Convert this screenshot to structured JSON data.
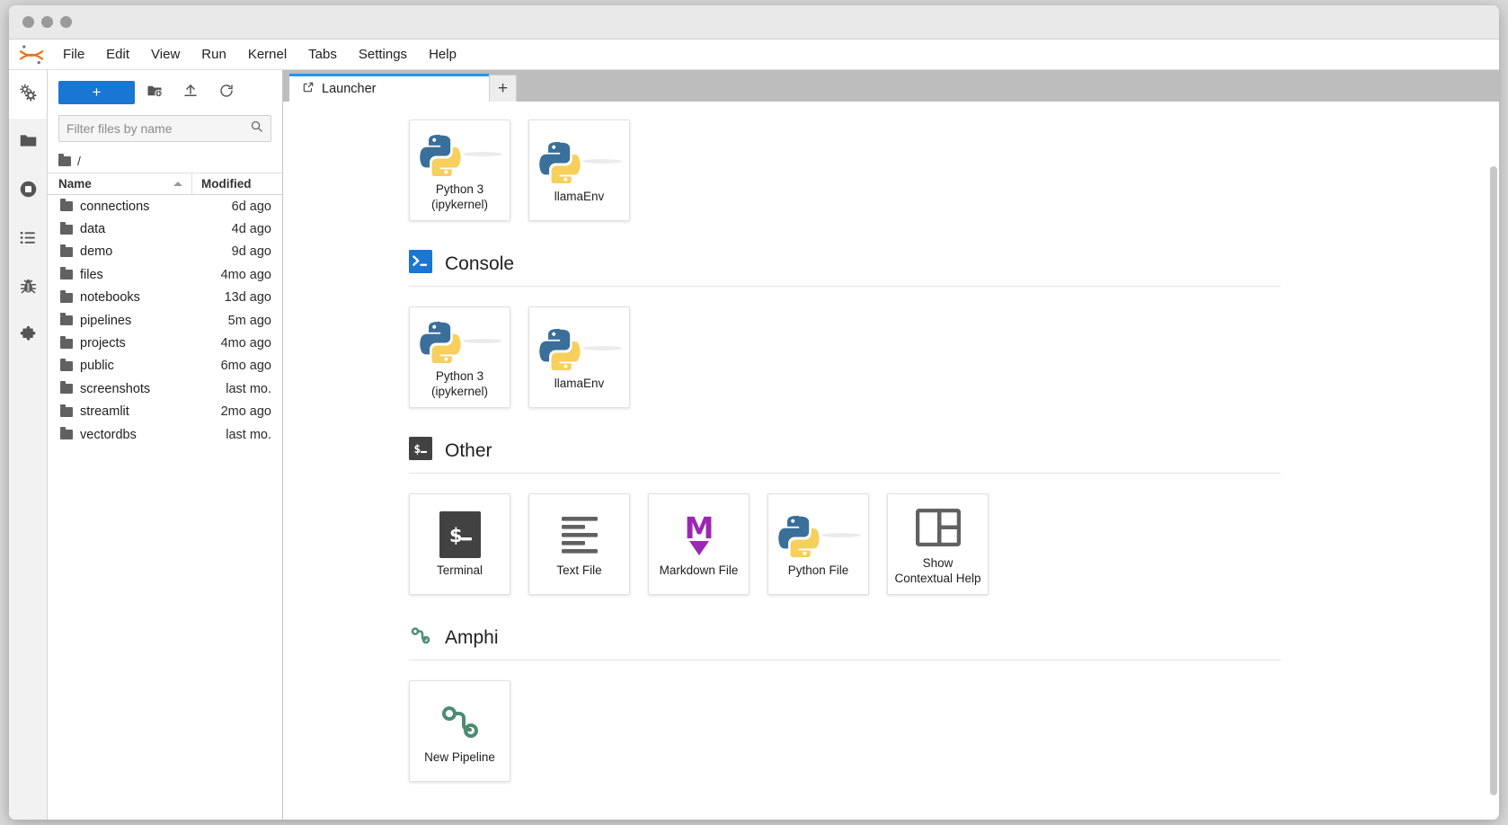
{
  "window": {
    "traffic_lights": [
      "close",
      "minimize",
      "maximize"
    ]
  },
  "menubar": {
    "logo": "jupyter-logo",
    "items": [
      {
        "label": "File"
      },
      {
        "label": "Edit"
      },
      {
        "label": "View"
      },
      {
        "label": "Run"
      },
      {
        "label": "Kernel"
      },
      {
        "label": "Tabs"
      },
      {
        "label": "Settings"
      },
      {
        "label": "Help"
      }
    ]
  },
  "rail": {
    "items": [
      {
        "name": "property-inspector",
        "icon": "gears-icon",
        "active": false
      },
      {
        "name": "file-browser",
        "icon": "folder-icon",
        "active": true
      },
      {
        "name": "running-terminals-kernels",
        "icon": "stop-circle-icon",
        "active": false
      },
      {
        "name": "table-of-contents",
        "icon": "list-icon",
        "active": false
      },
      {
        "name": "debugger",
        "icon": "bug-icon",
        "active": false
      },
      {
        "name": "extension-manager",
        "icon": "puzzle-icon",
        "active": false
      }
    ]
  },
  "filebrowser": {
    "toolbar": {
      "new_launcher_label": "+",
      "new_folder_icon": "new-folder-icon",
      "upload_icon": "upload-icon",
      "refresh_icon": "refresh-icon"
    },
    "filter": {
      "placeholder": "Filter files by name",
      "value": "",
      "icon": "search-icon"
    },
    "breadcrumb": {
      "root_icon": "folder-icon",
      "path": "/"
    },
    "columns": {
      "name": "Name",
      "modified": "Modified",
      "sort_column": "Name",
      "sort_direction": "ascending"
    },
    "files": [
      {
        "name": "connections",
        "modified": "6d ago",
        "type": "folder"
      },
      {
        "name": "data",
        "modified": "4d ago",
        "type": "folder"
      },
      {
        "name": "demo",
        "modified": "9d ago",
        "type": "folder"
      },
      {
        "name": "files",
        "modified": "4mo ago",
        "type": "folder"
      },
      {
        "name": "notebooks",
        "modified": "13d ago",
        "type": "folder"
      },
      {
        "name": "pipelines",
        "modified": "5m ago",
        "type": "folder"
      },
      {
        "name": "projects",
        "modified": "4mo ago",
        "type": "folder"
      },
      {
        "name": "public",
        "modified": "6mo ago",
        "type": "folder"
      },
      {
        "name": "screenshots",
        "modified": "last mo.",
        "type": "folder"
      },
      {
        "name": "streamlit",
        "modified": "2mo ago",
        "type": "folder"
      },
      {
        "name": "vectordbs",
        "modified": "last mo.",
        "type": "folder"
      }
    ]
  },
  "tabbar": {
    "tabs": [
      {
        "label": "Launcher",
        "icon": "launcher-icon",
        "active": true
      }
    ],
    "add_tab_label": "+"
  },
  "launcher": {
    "sections": [
      {
        "id": "notebook",
        "title": "",
        "icon": "",
        "cards": [
          {
            "label": "Python 3\n(ipykernel)",
            "icon": "python-logo-icon"
          },
          {
            "label": "llamaEnv",
            "icon": "python-logo-icon"
          }
        ]
      },
      {
        "id": "console",
        "title": "Console",
        "icon": "console-terminal-icon",
        "cards": [
          {
            "label": "Python 3\n(ipykernel)",
            "icon": "python-logo-icon"
          },
          {
            "label": "llamaEnv",
            "icon": "python-logo-icon"
          }
        ]
      },
      {
        "id": "other",
        "title": "Other",
        "icon": "dollar-terminal-icon",
        "cards": [
          {
            "label": "Terminal",
            "icon": "terminal-icon"
          },
          {
            "label": "Text File",
            "icon": "text-file-icon"
          },
          {
            "label": "Markdown File",
            "icon": "markdown-icon"
          },
          {
            "label": "Python File",
            "icon": "python-logo-icon"
          },
          {
            "label": "Show\nContextual Help",
            "icon": "contextual-help-icon"
          }
        ]
      },
      {
        "id": "amphi",
        "title": "Amphi",
        "icon": "amphi-pipeline-icon",
        "cards": [
          {
            "label": "New Pipeline",
            "icon": "amphi-pipeline-icon"
          }
        ]
      }
    ]
  },
  "colors": {
    "accent_blue": "#1976d2",
    "tab_active_border": "#2196f3",
    "python_blue": "#3a6f9a",
    "python_yellow": "#f7cf5d",
    "markdown_purple": "#9c27b0",
    "amphi_green": "#4c8c72",
    "terminal_dark": "#424242"
  }
}
